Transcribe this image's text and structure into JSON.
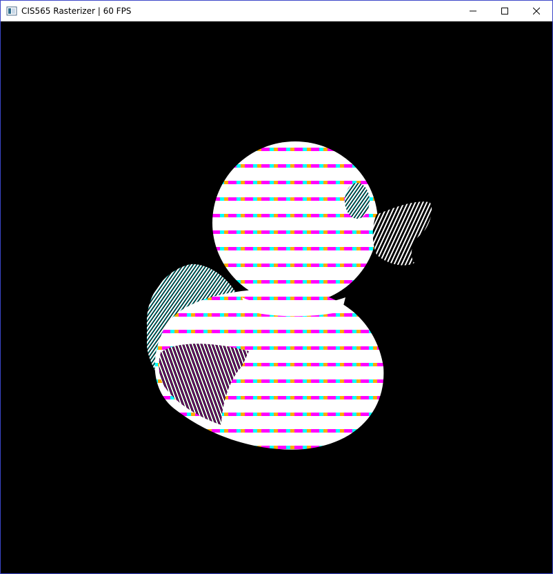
{
  "window": {
    "title": "CIS565 Rasterizer | 60 FPS",
    "controls": {
      "minimize_icon": "minimize-icon",
      "maximize_icon": "maximize-icon",
      "close_icon": "close-icon"
    }
  },
  "render": {
    "background_color": "#000000",
    "stripe_colors": [
      "#ff00ff",
      "#00ffff",
      "#ffaa00",
      "#ffffff"
    ],
    "subject": "duck-model"
  }
}
